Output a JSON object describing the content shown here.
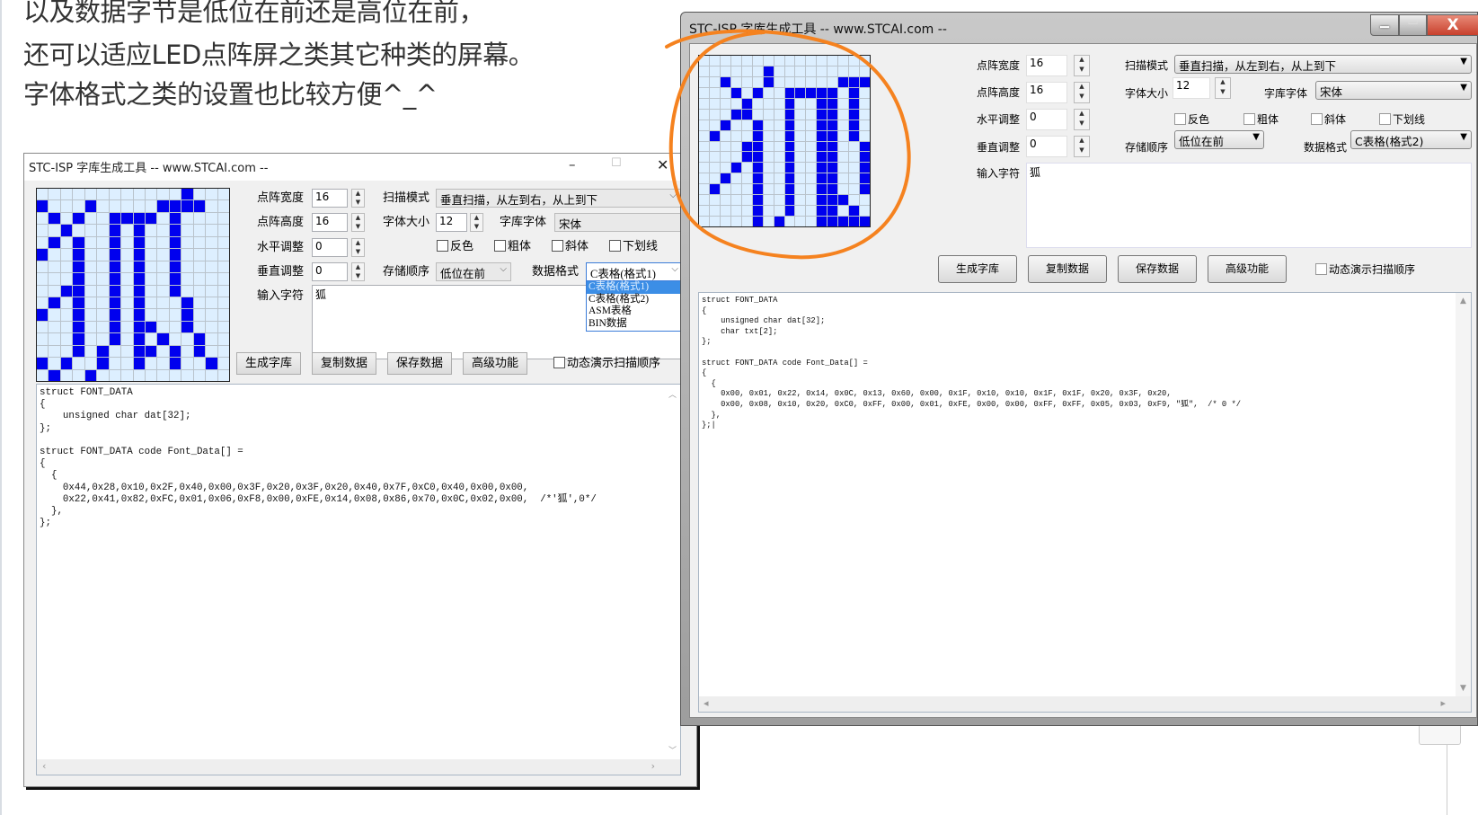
{
  "article": {
    "lines": [
      "以及数据字节是低位在前还是高位在前，",
      "还可以适应LED点阵屏之类其它种类的屏幕。",
      "字体格式之类的设置也比较方便^_^"
    ]
  },
  "left_window": {
    "title": "STC-ISP 字库生成工具 -- www.STCAI.com --",
    "controls": {
      "minimize": "–",
      "maximize": "☐",
      "close": "✕"
    },
    "labels": {
      "width": "点阵宽度",
      "height": "点阵高度",
      "h_adjust": "水平调整",
      "v_adjust": "垂直调整",
      "input_char": "输入字符",
      "scan_mode": "扫描模式",
      "font_size": "字体大小",
      "font_face": "字库字体",
      "storage_order": "存储顺序",
      "data_format": "数据格式"
    },
    "values": {
      "width": "16",
      "height": "16",
      "h_adjust": "0",
      "v_adjust": "0",
      "font_size": "12",
      "scan_mode": "垂直扫描，从左到右，从上到下",
      "font_face": "宋体",
      "storage_order": "低位在前",
      "data_format": "C表格(格式1)",
      "input_char": "狐"
    },
    "checkboxes": [
      "反色",
      "粗体",
      "斜体",
      "下划线"
    ],
    "buttons": [
      "生成字库",
      "复制数据",
      "保存数据",
      "高级功能"
    ],
    "demo_checkbox": "动态演示扫描顺序",
    "dropdown_options": [
      "C表格(格式1)",
      "C表格(格式2)",
      "ASM表格",
      "BIN数据"
    ],
    "dropdown_selected_index": 0,
    "code_lines": [
      "struct FONT_DATA",
      "{",
      "    unsigned char dat[32];",
      "};",
      "",
      "struct FONT_DATA code Font_Data[] =",
      "{",
      "  {",
      "    0x44,0x28,0x10,0x2F,0x40,0x00,0x3F,0x20,0x3F,0x20,0x40,0x7F,0xC0,0x40,0x00,0x00,",
      "    0x22,0x41,0x82,0xFC,0x01,0x06,0xF8,0x00,0xFE,0x14,0x08,0x86,0x70,0x0C,0x02,0x00,  /*'狐',0*/",
      "  },",
      "};"
    ],
    "dot_matrix": [
      "0000000000001000",
      "1000100000111100",
      "0101001111010000",
      "0010001010010000",
      "0101001010010000",
      "1001001010010000",
      "0001001010010000",
      "0001001010010000",
      "0011001010010000",
      "0101001010001000",
      "1001001010001000",
      "0001001011001000",
      "0001001010100100",
      "0001010011010100",
      "1010010010010010",
      "0100100000000000"
    ]
  },
  "right_window": {
    "title": "STC-ISP 字库生成工具 -- www.STCAI.com --",
    "controls": {
      "minimize": "▁",
      "maximize": "▭",
      "close": "X"
    },
    "labels": {
      "width": "点阵宽度",
      "height": "点阵高度",
      "h_adjust": "水平调整",
      "v_adjust": "垂直调整",
      "input_char": "输入字符",
      "scan_mode": "扫描模式",
      "font_size": "字体大小",
      "font_face": "字库字体",
      "storage_order": "存储顺序",
      "data_format": "数据格式"
    },
    "values": {
      "width": "16",
      "height": "16",
      "h_adjust": "0",
      "v_adjust": "0",
      "font_size": "12",
      "scan_mode": "垂直扫描，从左到右，从上到下",
      "font_face": "宋体",
      "storage_order": "低位在前",
      "data_format": "C表格(格式2)",
      "input_char": "狐"
    },
    "checkboxes": [
      "反色",
      "粗体",
      "斜体",
      "下划线"
    ],
    "buttons": [
      "生成字库",
      "复制数据",
      "保存数据",
      "高级功能"
    ],
    "demo_checkbox": "动态演示扫描顺序",
    "code_lines": [
      "struct FONT_DATA",
      "{",
      "    unsigned char dat[32];",
      "    char txt[2];",
      "};",
      "",
      "struct FONT_DATA code Font_Data[] =",
      "{",
      "  {",
      "    0x00, 0x01, 0x22, 0x14, 0x0C, 0x13, 0x60, 0x00, 0x1F, 0x10, 0x10, 0x1F, 0x1F, 0x20, 0x3F, 0x20,",
      "    0x00, 0x08, 0x10, 0x20, 0xC0, 0xFF, 0x00, 0x01, 0xFE, 0x00, 0x00, 0xFF, 0xFF, 0x05, 0x03, 0xF9, \"狐\",  /* 0 */",
      "  },",
      "};|"
    ],
    "dot_matrix": [
      "0000000000000000",
      "0000001000000000",
      "0010001000000111",
      "0001010011111010",
      "0000100010011010",
      "0001100010011010",
      "0010010010011010",
      "0100010010011010",
      "0000110010011001",
      "0000110010011001",
      "0001010010011001",
      "0010010010011001",
      "0100010010011001",
      "0000010010011100",
      "0000010010011010",
      "0000010100011111"
    ]
  },
  "colors": {
    "pixel_on": "#0000ee",
    "pixel_off": "#ddefff",
    "annotation": "#f5821f",
    "close_button": "#c8402c"
  }
}
